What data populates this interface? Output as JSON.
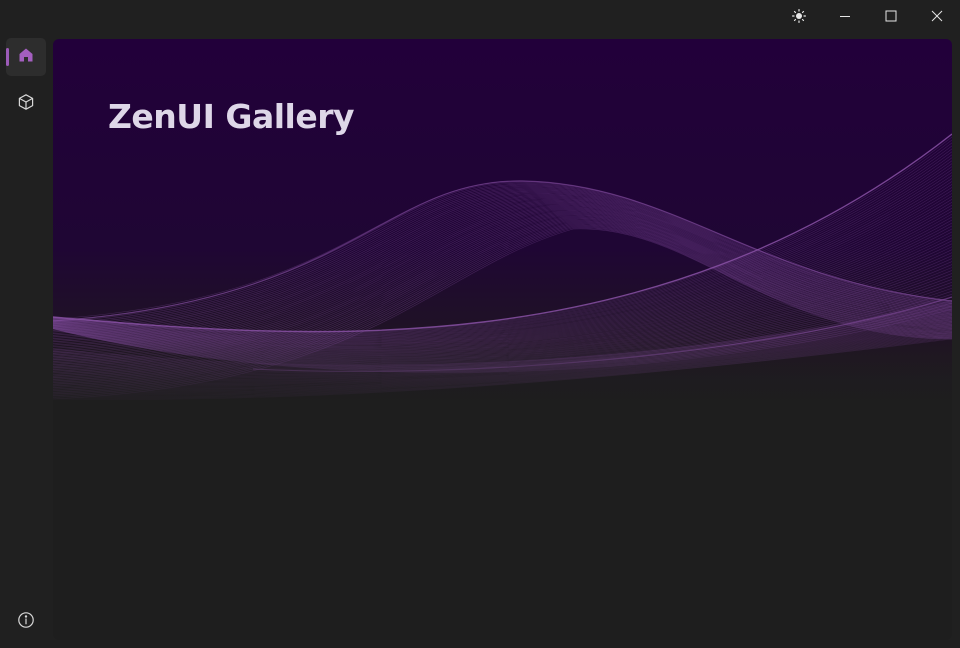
{
  "window": {
    "controls": {
      "theme": "sun-icon",
      "minimize": "minimize-icon",
      "maximize": "maximize-icon",
      "close": "close-icon"
    }
  },
  "sidebar": {
    "items": [
      {
        "name": "home",
        "icon": "home-icon",
        "active": true
      },
      {
        "name": "components",
        "icon": "cube-icon",
        "active": false
      }
    ],
    "footer": {
      "name": "about",
      "icon": "info-icon"
    }
  },
  "hero": {
    "title": "ZenUI Gallery"
  },
  "colors": {
    "accent": "#9c5bb8",
    "hero_top": "#22003a",
    "background": "#1e1e1e",
    "wave": "#8b52a8"
  }
}
